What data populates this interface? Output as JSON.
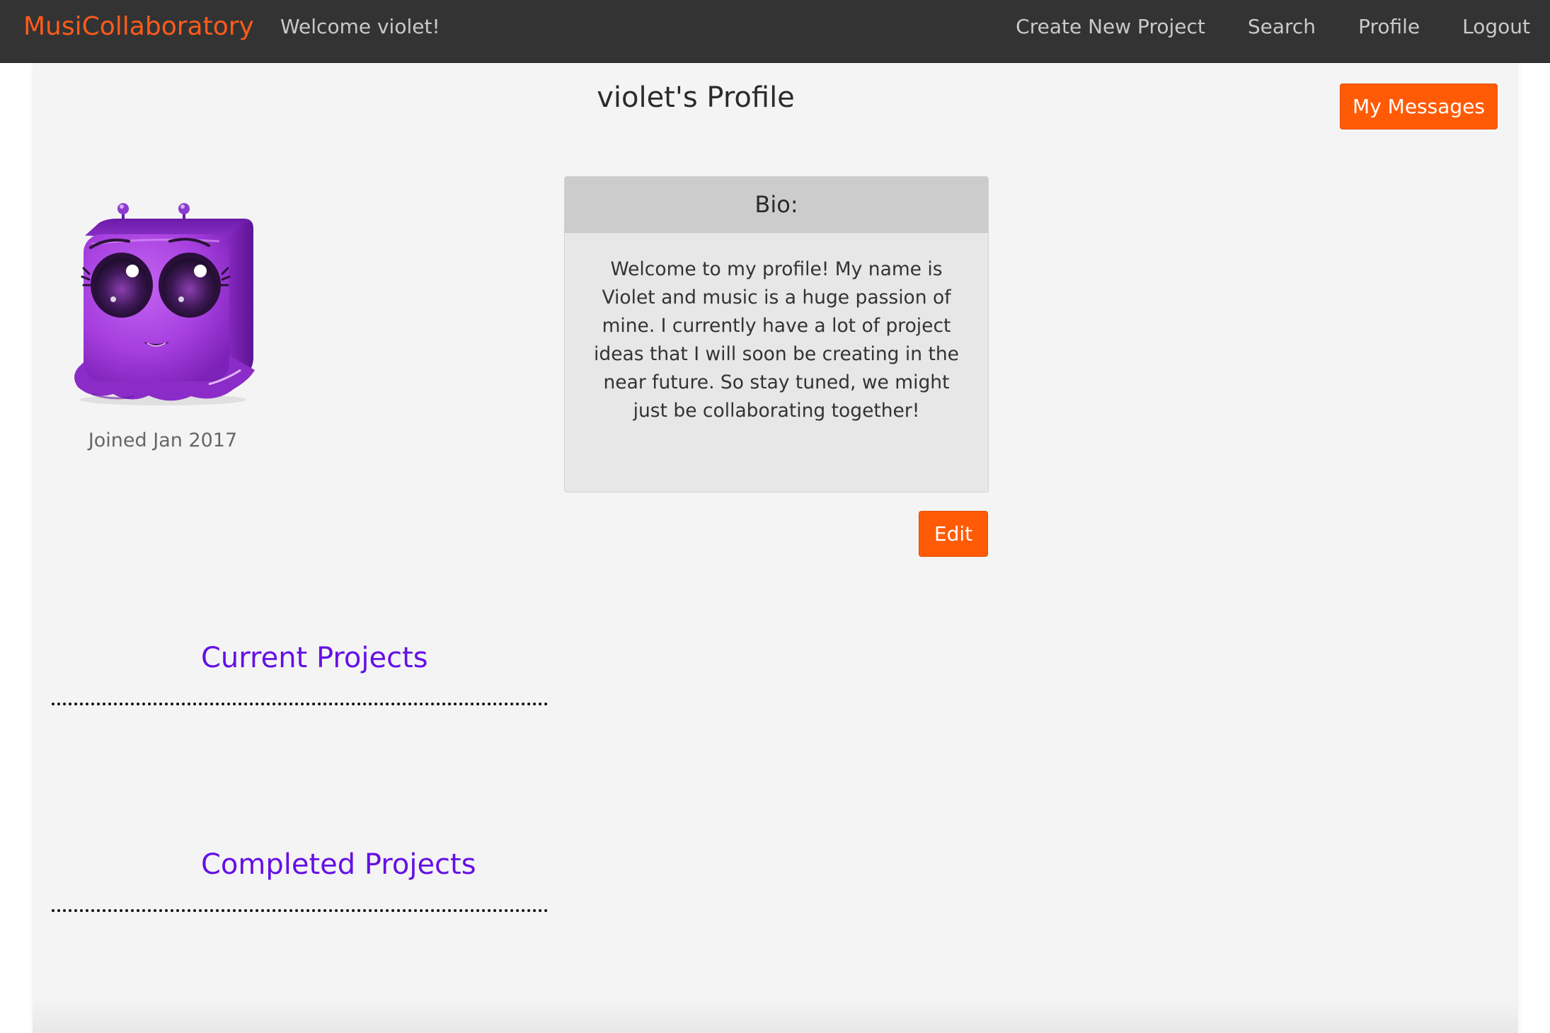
{
  "nav": {
    "brand": "MusiCollaboratory",
    "welcome": "Welcome violet!",
    "links": [
      "Create New Project",
      "Search",
      "Profile",
      "Logout"
    ]
  },
  "profile": {
    "title": "violet's Profile",
    "messages_button": "My Messages",
    "avatar_icon": "purple-alien-avatar",
    "joined": "Joined Jan 2017",
    "bio_heading": "Bio:",
    "bio_text": "Welcome to my profile! My name is Violet and music is a huge passion of mine. I currently have a lot of project ideas that I will soon be creating in the near future. So stay tuned, we might just be collaborating together!",
    "edit_button": "Edit"
  },
  "sections": {
    "current": "Current Projects",
    "completed": "Completed Projects"
  },
  "colors": {
    "accent_orange": "#ff5b06",
    "section_purple": "#6510e6",
    "nav_bg": "#333333"
  }
}
